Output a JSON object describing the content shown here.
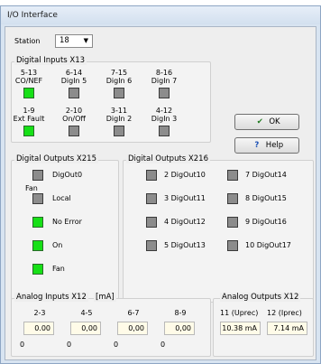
{
  "window": {
    "title": "I/O Interface"
  },
  "station": {
    "label": "Station",
    "value": "18"
  },
  "digital_inputs": {
    "title": "Digital Inputs X13",
    "items": [
      {
        "pins": "5-13",
        "name": "CO/NEF",
        "state": "on"
      },
      {
        "pins": "6-14",
        "name": "DigIn 5",
        "state": "off"
      },
      {
        "pins": "7-15",
        "name": "DigIn 6",
        "state": "off"
      },
      {
        "pins": "8-16",
        "name": "DigIn 7",
        "state": "off"
      },
      {
        "pins": "1-9",
        "name": "Ext Fault",
        "state": "on"
      },
      {
        "pins": "2-10",
        "name": "On/Off",
        "state": "off"
      },
      {
        "pins": "3-11",
        "name": "DigIn 2",
        "state": "off"
      },
      {
        "pins": "4-12",
        "name": "DigIn 3",
        "state": "off"
      }
    ]
  },
  "buttons": {
    "ok": "OK",
    "help": "Help"
  },
  "digital_outputs_x215": {
    "title": "Digital Outputs X215",
    "fan_label": "Fan",
    "items": [
      {
        "name": "DigOut0",
        "state": "off"
      },
      {
        "name": "Local",
        "state": "off"
      },
      {
        "name": "No Error",
        "state": "on"
      },
      {
        "name": "On",
        "state": "on"
      },
      {
        "name": "Fan",
        "state": "on"
      }
    ]
  },
  "digital_outputs_x216": {
    "title": "Digital Outputs X216",
    "items": [
      {
        "name": "2 DigOut10",
        "state": "off"
      },
      {
        "name": "3 DigOut11",
        "state": "off"
      },
      {
        "name": "4 DigOut12",
        "state": "off"
      },
      {
        "name": "5 DigOut13",
        "state": "off"
      },
      {
        "name": "7 DigOut14",
        "state": "off"
      },
      {
        "name": "8 DigOut15",
        "state": "off"
      },
      {
        "name": "9 DigOut16",
        "state": "off"
      },
      {
        "name": "10 DigOut17",
        "state": "off"
      }
    ]
  },
  "analog_inputs": {
    "title": "Analog Inputs X12",
    "unit": "[mA]",
    "channels": [
      {
        "pins": "2-3",
        "value": "0.00",
        "min": "0"
      },
      {
        "pins": "4-5",
        "value": "0,00",
        "min": "0"
      },
      {
        "pins": "6-7",
        "value": "0,00",
        "min": "0"
      },
      {
        "pins": "8-9",
        "value": "0,00",
        "min": "0"
      }
    ]
  },
  "analog_outputs": {
    "title": "Analog Outputs  X12",
    "channels": [
      {
        "name": "11 (Uprec)",
        "value": "10.38 mA"
      },
      {
        "name": "12 (Iprec)",
        "value": "7.14 mA"
      }
    ]
  },
  "colors": {
    "led_on": "#17e017",
    "led_off": "#8c8c8c",
    "titlebar": "#dbe6f3"
  }
}
